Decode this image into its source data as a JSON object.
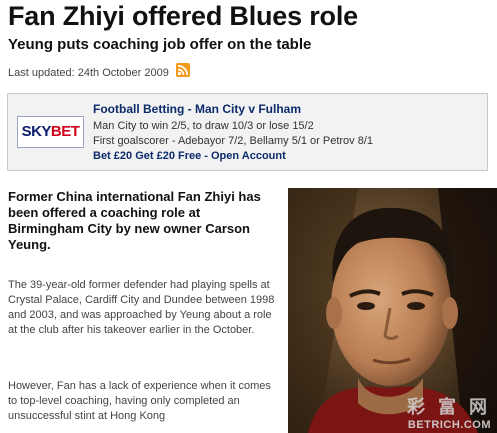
{
  "article": {
    "headline": "Fan Zhiyi offered Blues role",
    "subheadline": "Yeung puts coaching job offer on the table",
    "last_updated": "Last updated: 24th October 2009",
    "intro": "Former China international Fan Zhiyi has been offered a coaching role at Birmingham City by new owner Carson Yeung.",
    "paragraphs": [
      "The 39-year-old former defender had playing spells at Crystal Palace, Cardiff City and Dundee between 1998 and 2003, and was approached by Yeung about a role at the club after his takeover earlier in the October.",
      "However, Fan has a lack of experience when it comes to top-level coaching, having only completed an unsuccessful stint at Hong Kong"
    ]
  },
  "ad": {
    "logo_sky": "SKY",
    "logo_bet": "BET",
    "title": "Football Betting - Man City v Fulham",
    "line1": "Man City to win 2/5, to draw 10/3 or lose 15/2",
    "line2": "First goalscorer - Adebayor 7/2, Bellamy 5/1 or Petrov 8/1",
    "line3": "Bet £20 Get £20 Free - Open Account"
  },
  "photo": {
    "watermark_cn": "彩 富 网",
    "watermark_url": "BETRICH.COM"
  },
  "colors": {
    "rss": "#f59a1b",
    "ad_title": "#0b2b6b",
    "sky_blue": "#0b1a6b",
    "bet_red": "#d0021b"
  },
  "icons": [
    "rss-feed-icon"
  ]
}
